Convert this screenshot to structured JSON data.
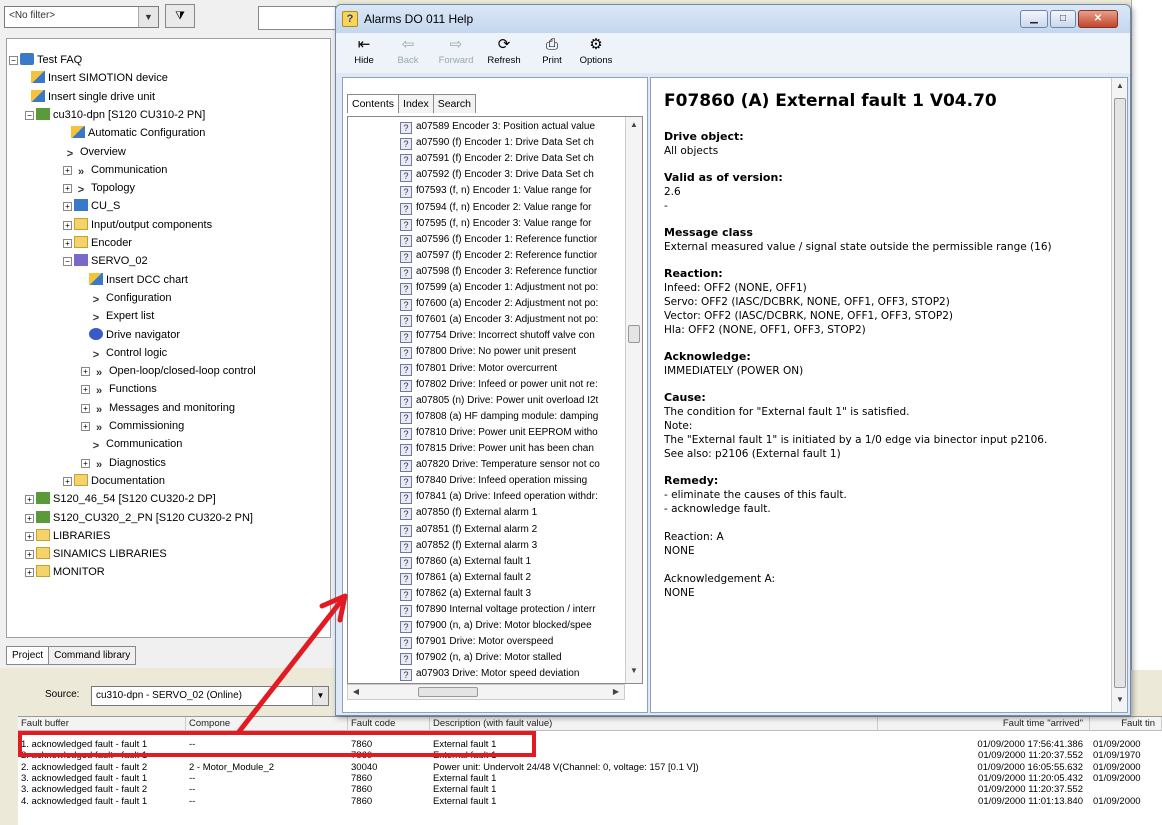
{
  "left_pane": {
    "filter": "<No filter>",
    "tree": [
      {
        "label": "Test FAQ",
        "icon": "project-icon"
      },
      {
        "label": "Insert SIMOTION device",
        "icon": "insert-icon"
      },
      {
        "label": "Insert single drive unit",
        "icon": "insert-icon"
      },
      {
        "label": "cu310-dpn [S120 CU310-2 PN]",
        "icon": "device-icon"
      },
      {
        "label": "Automatic Configuration",
        "icon": "insert-icon"
      },
      {
        "label": "Overview",
        "icon": "arrow-icon"
      },
      {
        "label": "Communication",
        "icon": "double-arrow-icon"
      },
      {
        "label": "Topology",
        "icon": "arrow-icon"
      },
      {
        "label": "CU_S",
        "icon": "cu-icon"
      },
      {
        "label": "Input/output components",
        "icon": "folder-icon"
      },
      {
        "label": "Encoder",
        "icon": "folder-icon"
      },
      {
        "label": "SERVO_02",
        "icon": "drive-icon"
      },
      {
        "label": "Insert DCC chart",
        "icon": "insert-icon"
      },
      {
        "label": "Configuration",
        "icon": "arrow-icon"
      },
      {
        "label": "Expert list",
        "icon": "arrow-icon"
      },
      {
        "label": "Drive navigator",
        "icon": "navigator-icon"
      },
      {
        "label": "Control logic",
        "icon": "arrow-icon"
      },
      {
        "label": "Open-loop/closed-loop control",
        "icon": "double-arrow-icon"
      },
      {
        "label": "Functions",
        "icon": "double-arrow-icon"
      },
      {
        "label": "Messages and monitoring",
        "icon": "double-arrow-icon"
      },
      {
        "label": "Commissioning",
        "icon": "double-arrow-icon"
      },
      {
        "label": "Communication",
        "icon": "arrow-icon"
      },
      {
        "label": "Diagnostics",
        "icon": "double-arrow-icon"
      },
      {
        "label": "Documentation",
        "icon": "folder-icon"
      },
      {
        "label": "S120_46_54 [S120 CU320-2 DP]",
        "icon": "device-icon"
      },
      {
        "label": "S120_CU320_2_PN [S120 CU320-2 PN]",
        "icon": "device-icon"
      },
      {
        "label": "LIBRARIES",
        "icon": "folder-icon"
      },
      {
        "label": "SINAMICS LIBRARIES",
        "icon": "folder-icon"
      },
      {
        "label": "MONITOR",
        "icon": "folder-icon"
      }
    ],
    "tabs": [
      "Project",
      "Command library"
    ]
  },
  "help_window": {
    "title": "Alarms DO 011 Help",
    "toolbar": {
      "hide": "Hide",
      "back": "Back",
      "forward": "Forward",
      "refresh": "Refresh",
      "print": "Print",
      "options": "Options"
    },
    "nav_tabs": [
      "Contents",
      "Index",
      "Search"
    ],
    "toc": [
      "a07589 Encoder 3: Position actual value",
      "a07590 (f) Encoder 1: Drive Data Set ch",
      "a07591 (f) Encoder 2: Drive Data Set ch",
      "a07592 (f) Encoder 3: Drive Data Set ch",
      "f07593 (f, n) Encoder 1: Value range for",
      "f07594 (f, n) Encoder 2: Value range for",
      "f07595 (f, n) Encoder 3: Value range for",
      "a07596 (f) Encoder 1: Reference functior",
      "a07597 (f) Encoder 2: Reference functior",
      "a07598 (f) Encoder 3: Reference functior",
      "f07599 (a) Encoder 1: Adjustment not po:",
      "f07600 (a) Encoder 2: Adjustment not po:",
      "f07601 (a) Encoder 3: Adjustment not po:",
      "f07754 Drive: Incorrect shutoff valve con",
      "f07800 Drive: No power unit present",
      "f07801 Drive: Motor overcurrent",
      "f07802 Drive: Infeed or power unit not re:",
      "a07805 (n) Drive: Power unit overload I2t",
      "f07808 (a) HF damping module: damping",
      "f07810 Drive: Power unit EEPROM witho",
      "f07815 Drive: Power unit has been chan",
      "a07820 Drive: Temperature sensor not co",
      "f07840 Drive: Infeed operation missing",
      "f07841 (a) Drive: Infeed operation withdr:",
      "a07850 (f) External alarm 1",
      "a07851 (f) External alarm 2",
      "a07852 (f) External alarm 3",
      "f07860 (a) External fault 1",
      "f07861 (a) External fault 2",
      "f07862 (a) External fault 3",
      "f07890 Internal voltage protection / interr",
      "f07900 (n, a) Drive: Motor blocked/spee",
      "f07901 Drive: Motor overspeed",
      "f07902 (n, a) Drive: Motor stalled",
      "a07903 Drive: Motor speed deviation"
    ],
    "content": {
      "heading": "F07860 (A) External fault 1 V04.70",
      "sections": [
        {
          "title": "Drive object:",
          "body": "All objects"
        },
        {
          "title": "Valid as of version:",
          "body": "2.6\n-"
        },
        {
          "title": "Message class",
          "body": "External measured value / signal state outside the permissible range (16)"
        },
        {
          "title": "Reaction:",
          "body": "Infeed: OFF2 (NONE, OFF1)\nServo: OFF2 (IASC/DCBRK, NONE, OFF1, OFF3, STOP2)\nVector: OFF2 (IASC/DCBRK, NONE, OFF1, OFF3, STOP2)\nHla: OFF2 (NONE, OFF1, OFF3, STOP2)"
        },
        {
          "title": "Acknowledge:",
          "body": "IMMEDIATELY (POWER ON)"
        },
        {
          "title": "Cause:",
          "body": "The condition for \"External fault 1\" is satisfied.\nNote:\nThe \"External fault 1\" is initiated by a 1/0 edge via binector input p2106.\nSee also: p2106 (External fault 1)"
        },
        {
          "title": "Remedy:",
          "body": "- eliminate the causes of this fault.\n- acknowledge fault."
        },
        {
          "title": "",
          "body": "Reaction: A\nNONE"
        },
        {
          "title": "",
          "body": "Acknowledgement A:\nNONE"
        }
      ]
    }
  },
  "bottom_pane": {
    "source_label": "Source:",
    "source_value": "cu310-dpn - SERVO_02 (Online)",
    "columns": [
      "Fault buffer",
      "Compone",
      "Fault code",
      "Description (with fault value)",
      "Fault time \"arrived\"",
      "Fault tin"
    ],
    "rows": [
      [
        "1. acknowledged fault - fault 1",
        "--",
        "7860",
        "External fault 1",
        "01/09/2000 17:56:41.386",
        "01/09/2000"
      ],
      [
        "2. acknowledged fault - fault 1",
        "--",
        "7860",
        "External fault 1",
        "01/09/2000 11:20:37.552",
        "01/09/1970"
      ],
      [
        "2. acknowledged fault - fault 2",
        "2 - Motor_Module_2",
        "30040",
        "Power unit: Undervolt 24/48 V(Channel: 0, voltage: 157 [0.1 V])",
        "01/09/2000 16:05:55.632",
        "01/09/2000"
      ],
      [
        "3. acknowledged fault - fault 1",
        "--",
        "7860",
        "External fault 1",
        "01/09/2000 11:20:05.432",
        "01/09/2000"
      ],
      [
        "3. acknowledged fault - fault 2",
        "--",
        "7860",
        "External fault 1",
        "01/09/2000 11:20:37.552",
        ""
      ],
      [
        "4. acknowledged fault - fault 1",
        "--",
        "7860",
        "External fault 1",
        "01/09/2000 11:01:13.840",
        "01/09/2000"
      ]
    ]
  },
  "colors": {
    "highlight": "#e21b23",
    "title_bar": "#c4d7ee"
  }
}
